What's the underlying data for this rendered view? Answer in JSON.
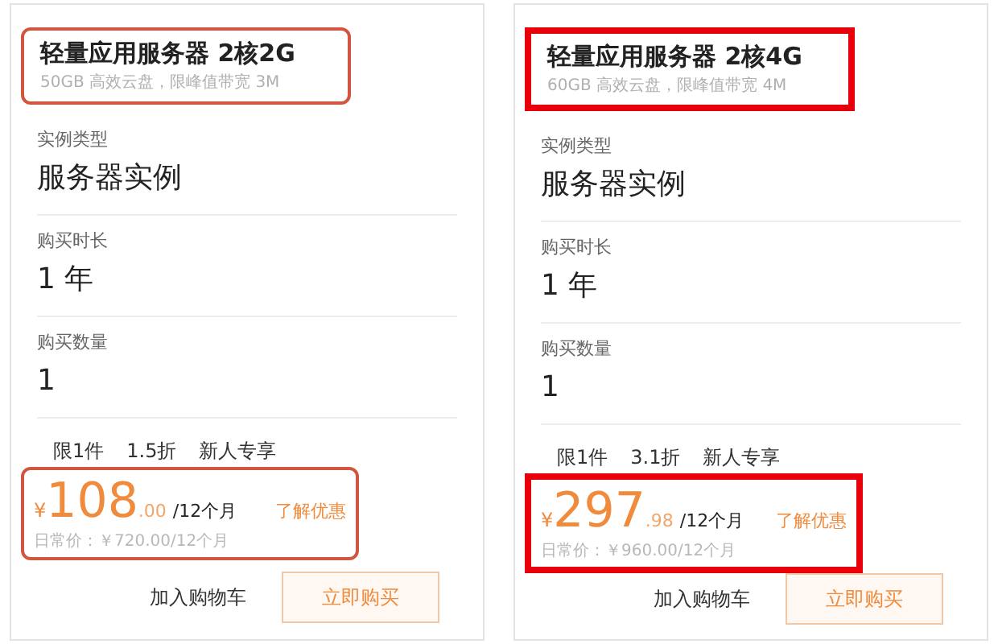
{
  "cards": [
    {
      "kind": "thin",
      "title": "轻量应用服务器 2核2G",
      "spec": "50GB 高效云盘，限峰值带宽 3M",
      "fields": [
        {
          "label": "实例类型",
          "value": "服务器实例"
        },
        {
          "label": "购买时长",
          "value": "1 年"
        },
        {
          "label": "购买数量",
          "value": "1"
        }
      ],
      "tags": [
        "限1件",
        "1.5折",
        "新人专享"
      ],
      "price": {
        "currency": "¥",
        "integer": "108",
        "decimal": ".00",
        "period": "/12个月",
        "link": "了解优惠",
        "original": "日常价：￥720.00/12个月"
      },
      "buttons": [
        "加入购物车",
        "立即购买"
      ]
    },
    {
      "kind": "thick",
      "title": "轻量应用服务器 2核4G",
      "spec": "60GB 高效云盘，限峰值带宽 4M",
      "fields": [
        {
          "label": "实例类型",
          "value": "服务器实例"
        },
        {
          "label": "购买时长",
          "value": "1 年"
        },
        {
          "label": "购买数量",
          "value": "1"
        }
      ],
      "tags": [
        "限1件",
        "3.1折",
        "新人专享"
      ],
      "price": {
        "currency": "¥",
        "integer": "297",
        "decimal": ".98",
        "period": "/12个月",
        "link": "了解优惠",
        "original": "日常价：￥960.00/12个月"
      },
      "buttons": [
        "加入购物车",
        "立即购买"
      ]
    }
  ]
}
